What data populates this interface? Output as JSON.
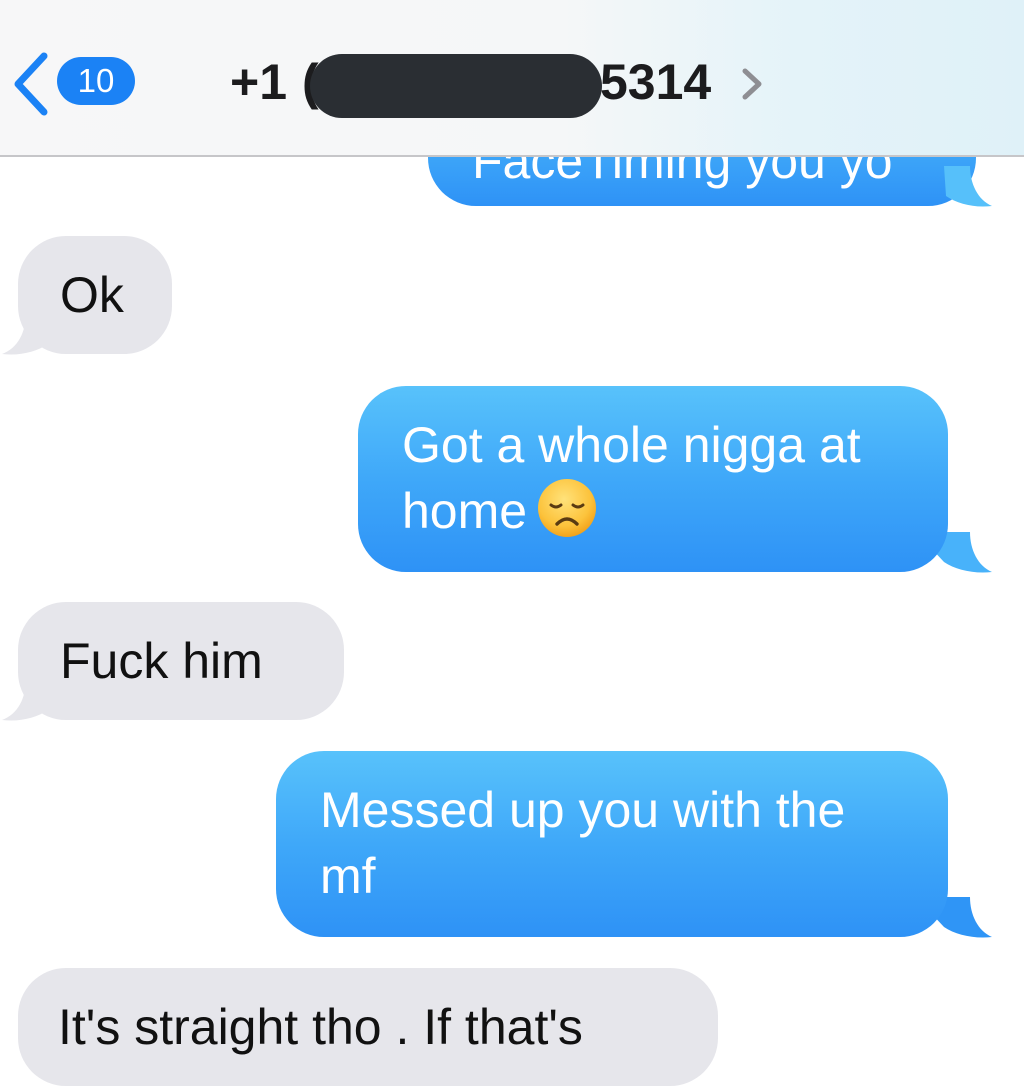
{
  "header": {
    "back_badge": "10",
    "contact_prefix": "+1",
    "contact_partial": "(",
    "contact_suffix": "5314",
    "icons": {
      "back": "chevron-left-icon",
      "details": "chevron-right-icon"
    }
  },
  "colors": {
    "sent_bubble": "#3fa8f9",
    "received_bubble": "#e6e6eb",
    "badge": "#1b82f5",
    "redaction": "#2a2e33"
  },
  "messages": [
    {
      "direction": "sent",
      "text": "FaceTiming you yo",
      "cut_off": "top"
    },
    {
      "direction": "received",
      "text": "Ok"
    },
    {
      "direction": "sent",
      "text": "Got a whole nigga at\nhome",
      "emoji": "disappointed-face-icon"
    },
    {
      "direction": "received",
      "text": "Fuck him"
    },
    {
      "direction": "sent",
      "text": "Messed up you with the\nmf"
    },
    {
      "direction": "received",
      "text": "It's straight tho . If that's",
      "cut_off": "bottom"
    }
  ]
}
